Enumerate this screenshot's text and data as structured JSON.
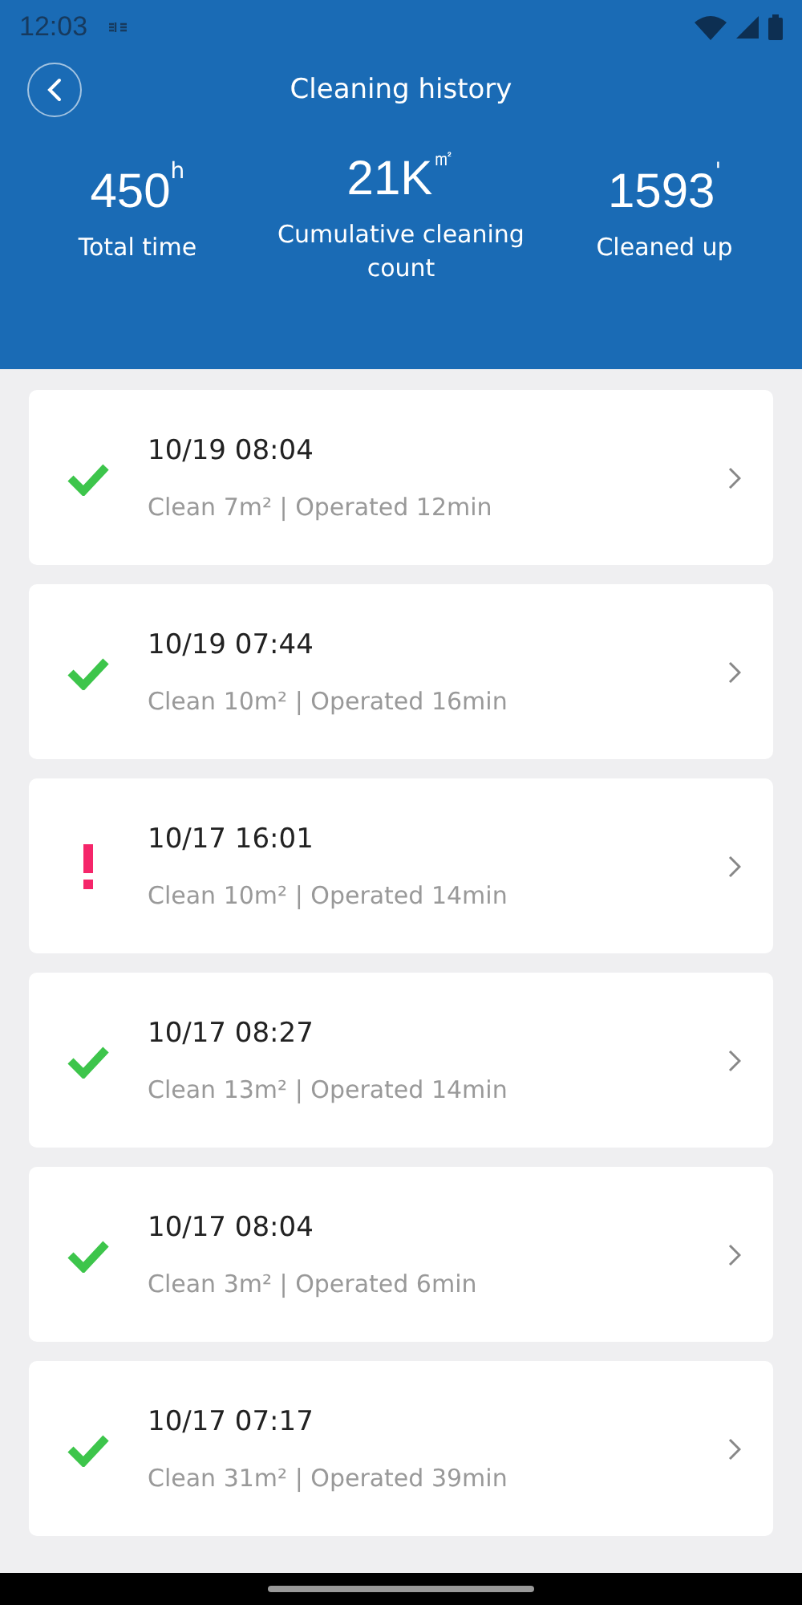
{
  "status_bar": {
    "time": "12:03"
  },
  "header": {
    "title": "Cleaning history"
  },
  "stats": [
    {
      "value": "450",
      "unit": "h",
      "label": "Total time"
    },
    {
      "value": "21K",
      "unit": "㎡",
      "label": "Cumulative cleaning count"
    },
    {
      "value": "1593",
      "unit": "'",
      "label": "Cleaned up"
    }
  ],
  "records": [
    {
      "kind": "success",
      "time": "10/19 08:04",
      "summary": "Clean 7m² | Operated 12min"
    },
    {
      "kind": "success",
      "time": "10/19 07:44",
      "summary": "Clean 10m² | Operated 16min"
    },
    {
      "kind": "error",
      "time": "10/17 16:01",
      "summary": "Clean 10m² | Operated 14min"
    },
    {
      "kind": "success",
      "time": "10/17 08:27",
      "summary": "Clean 13m² | Operated 14min"
    },
    {
      "kind": "success",
      "time": "10/17 08:04",
      "summary": "Clean 3m² | Operated 6min"
    },
    {
      "kind": "success",
      "time": "10/17 07:17",
      "summary": "Clean 31m² | Operated 39min"
    }
  ]
}
